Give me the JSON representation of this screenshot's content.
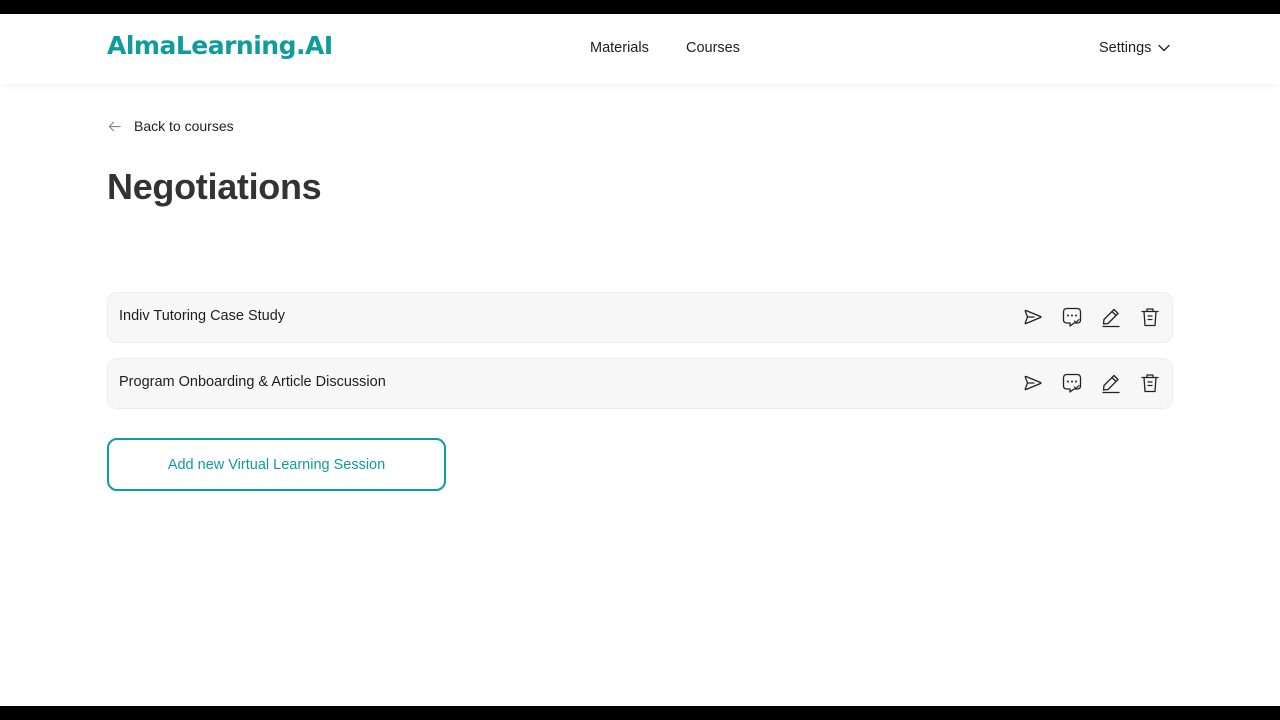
{
  "brand": {
    "logo": "AlmaLearning.AI",
    "accent_color": "#0e9c9c"
  },
  "nav": {
    "materials": "Materials",
    "courses": "Courses",
    "settings": "Settings",
    "settings_icon": "chevron-down-icon"
  },
  "back_link": {
    "label": "Back to courses",
    "icon": "arrow-left-icon"
  },
  "page_title": "Negotiations",
  "sessions": [
    {
      "name": "Indiv Tutoring Case Study"
    },
    {
      "name": "Program Onboarding & Article Discussion"
    }
  ],
  "row_actions": [
    "play-icon",
    "chat-check-icon",
    "edit-icon",
    "trash-icon"
  ],
  "add_button": "Add new Virtual Learning Session"
}
